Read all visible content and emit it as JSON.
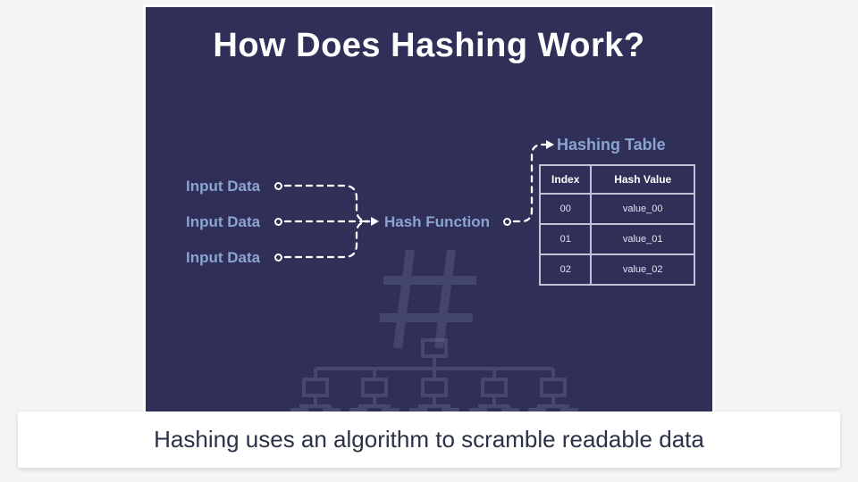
{
  "title": "How Does Hashing Work?",
  "inputs": [
    "Input Data",
    "Input Data",
    "Input Data"
  ],
  "hash_function": "Hash Function",
  "hashing_table": "Hashing Table",
  "table": {
    "headers": {
      "index": "Index",
      "value": "Hash Value"
    },
    "rows": [
      {
        "index": "00",
        "value": "value_00"
      },
      {
        "index": "01",
        "value": "value_01"
      },
      {
        "index": "02",
        "value": "value_02"
      }
    ]
  },
  "caption": "Hashing uses an algorithm to scramble readable data",
  "colors": {
    "card_bg": "#2f2f58",
    "label": "#8aa4cf",
    "title": "#ffffff",
    "caption_text": "#2b3247"
  }
}
